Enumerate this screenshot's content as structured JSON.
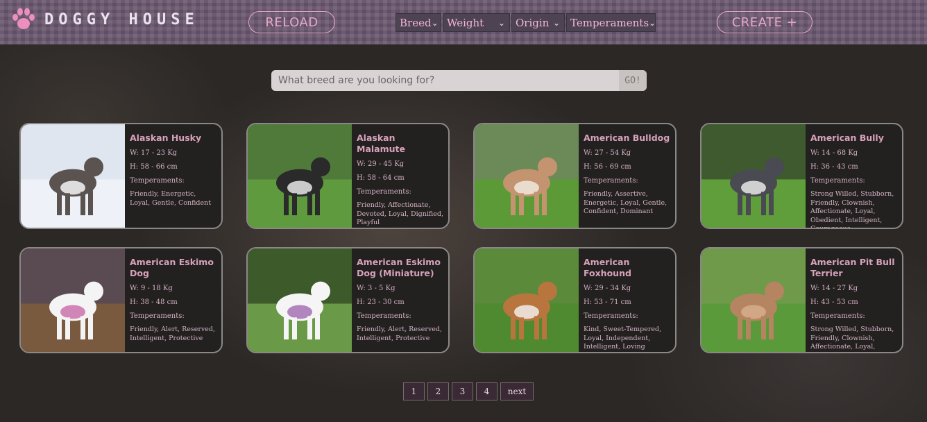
{
  "header": {
    "brand": "DOGGY HOUSE",
    "reload_label": "RELOAD",
    "create_label": "CREATE +",
    "filters": [
      {
        "label": "Breed",
        "width": 66
      },
      {
        "label": "Weight",
        "width": 97
      },
      {
        "label": "Origin",
        "width": 77
      },
      {
        "label": "Temperaments",
        "width": 129
      }
    ]
  },
  "search": {
    "placeholder": "What breed are you looking for?",
    "go_label": "GO!"
  },
  "cards": [
    {
      "name": "Alaskan Husky",
      "weight": "W: 17 - 23 Kg",
      "height": "H: 58 - 66 cm",
      "temps_label": "Temperaments:",
      "temps": "Friendly, Energetic, Loyal, Gentle, Confident",
      "bg": "#dfe6ef",
      "ground": "#eef2f8",
      "dog": "#5a5350",
      "accent": "#ffffff"
    },
    {
      "name": "Alaskan Malamute",
      "weight": "W: 29 - 45 Kg",
      "height": "H: 58 - 64 cm",
      "temps_label": "Temperaments:",
      "temps": "Friendly, Affectionate, Devoted, Loyal, Dignified, Playful",
      "bg": "#4f7a3a",
      "ground": "#5f9a3e",
      "dog": "#2a2a2a",
      "accent": "#f2f2f2"
    },
    {
      "name": "American Bulldog",
      "weight": "W: 27 - 54 Kg",
      "height": "H: 56 - 69 cm",
      "temps_label": "Temperaments:",
      "temps": "Friendly, Assertive, Energetic, Loyal, Gentle, Confident, Dominant",
      "bg": "#6c8a57",
      "ground": "#5c9a38",
      "dog": "#c49470",
      "accent": "#f3ece6"
    },
    {
      "name": "American Bully",
      "weight": "W: 14 - 68 Kg",
      "height": "H: 36 - 43 cm",
      "temps_label": "Temperaments:",
      "temps": "Strong Willed, Stubborn, Friendly, Clownish, Affectionate, Loyal, Obedient, Intelligent, Courageous",
      "bg": "#3f5a2e",
      "ground": "#5f9e3a",
      "dog": "#4a4a52",
      "accent": "#f1f1f1"
    },
    {
      "name": "American Eskimo Dog",
      "weight": "W: 9 - 18 Kg",
      "height": "H: 38 - 48 cm",
      "temps_label": "Temperaments:",
      "temps": "Friendly, Alert, Reserved, Intelligent, Protective",
      "bg": "#5a4a52",
      "ground": "#7a5a3e",
      "dog": "#f4f4f4",
      "accent": "#c86aa8"
    },
    {
      "name": "American Eskimo Dog (Miniature)",
      "weight": "W: 3 - 5 Kg",
      "height": "H: 23 - 30 cm",
      "temps_label": "Temperaments:",
      "temps": "Friendly, Alert, Reserved, Intelligent, Protective",
      "bg": "#3d5a2a",
      "ground": "#6a9a48",
      "dog": "#f5f5f5",
      "accent": "#a06ab0"
    },
    {
      "name": "American Foxhound",
      "weight": "W: 29 - 34 Kg",
      "height": "H: 53 - 71 cm",
      "temps_label": "Temperaments:",
      "temps": "Kind, Sweet-Tempered, Loyal, Independent, Intelligent, Loving",
      "bg": "#5a8a3a",
      "ground": "#4f8a30",
      "dog": "#b8763e",
      "accent": "#f5f5f5"
    },
    {
      "name": "American Pit Bull Terrier",
      "weight": "W: 14 - 27 Kg",
      "height": "H: 43 - 53 cm",
      "temps_label": "Temperaments:",
      "temps": "Strong Willed, Stubborn, Friendly, Clownish, Affectionate, Loyal, Obedient",
      "bg": "#6f9a4a",
      "ground": "#5a9a3a",
      "dog": "#b58460",
      "accent": "#d9b090"
    }
  ],
  "pagination": {
    "pages": [
      "1",
      "2",
      "3",
      "4"
    ],
    "next_label": "next"
  }
}
